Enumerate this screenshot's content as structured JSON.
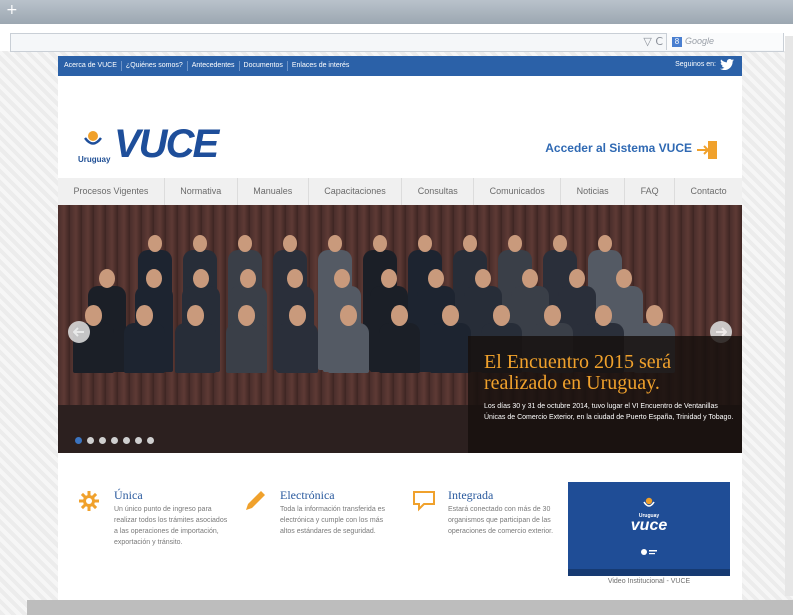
{
  "browser": {
    "new_tab_symbol": "+",
    "search_engine": "Google",
    "search_engine_badge": "8",
    "url_icons": "▽ C"
  },
  "topnav": {
    "links": [
      "Acerca de VUCE",
      "¿Quiénes somos?",
      "Antecedentes",
      "Documentos",
      "Enlaces de interés"
    ],
    "follow_label": "Seguinos en:"
  },
  "header": {
    "logo_text": "VUCE",
    "logo_country": "Uruguay",
    "access_label": "Acceder al Sistema VUCE"
  },
  "mainnav": {
    "items": [
      "Procesos Vigentes",
      "Normativa",
      "Manuales",
      "Capacitaciones",
      "Consultas",
      "Comunicados",
      "Noticias",
      "FAQ",
      "Contacto"
    ]
  },
  "hero": {
    "title": "El Encuentro 2015 será realizado en Uruguay.",
    "text": "Los días 30 y 31 de octubre 2014, tuvo lugar el VI Encuentro de Ventanillas Únicas de Comercio Exterior, en la ciudad de Puerto España, Trinidad y Tobago.",
    "slide_count": 7,
    "active_slide": 1
  },
  "features": [
    {
      "title": "Única",
      "text": "Un único punto de ingreso para realizar todos los trámites asociados a las operaciones de importación, exportación y tránsito.",
      "icon": "gear-icon"
    },
    {
      "title": "Electrónica",
      "text": "Toda la información transferida es electrónica y cumple con los más altos estándares de seguridad.",
      "icon": "pencil-icon"
    },
    {
      "title": "Integrada",
      "text": "Estará conectado con más de 30 organismos que participan de las operaciones de comercio exterior.",
      "icon": "speech-bubble-icon"
    }
  ],
  "video": {
    "logo_country": "Uruguay",
    "logo_text": "vuce",
    "caption": "Video Institucional - VUCE"
  },
  "colors": {
    "brand_blue": "#2b61a8",
    "accent_orange": "#f0a12c",
    "logo_blue": "#1e4e9a"
  }
}
